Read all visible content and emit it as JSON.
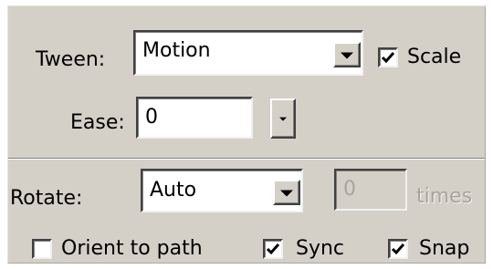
{
  "tween": {
    "label": "Tween:",
    "value": "Motion",
    "scale_checkbox": {
      "label": "Scale",
      "checked": true
    }
  },
  "ease": {
    "label": "Ease:",
    "value": "0"
  },
  "rotate": {
    "label": "Rotate:",
    "value": "Auto",
    "times_value": "0",
    "times_label": "times"
  },
  "options": {
    "orient_to_path": {
      "label": "Orient to path",
      "checked": false
    },
    "sync": {
      "label": "Sync",
      "checked": true
    },
    "snap": {
      "label": "Snap",
      "checked": true
    }
  },
  "icons": {
    "dropdown": "chevron-down-icon",
    "check": "checkmark-icon"
  },
  "colors": {
    "panel_bg": "#d4d0c8",
    "field_bg": "#ffffff",
    "disabled_text": "#a8a59e"
  }
}
